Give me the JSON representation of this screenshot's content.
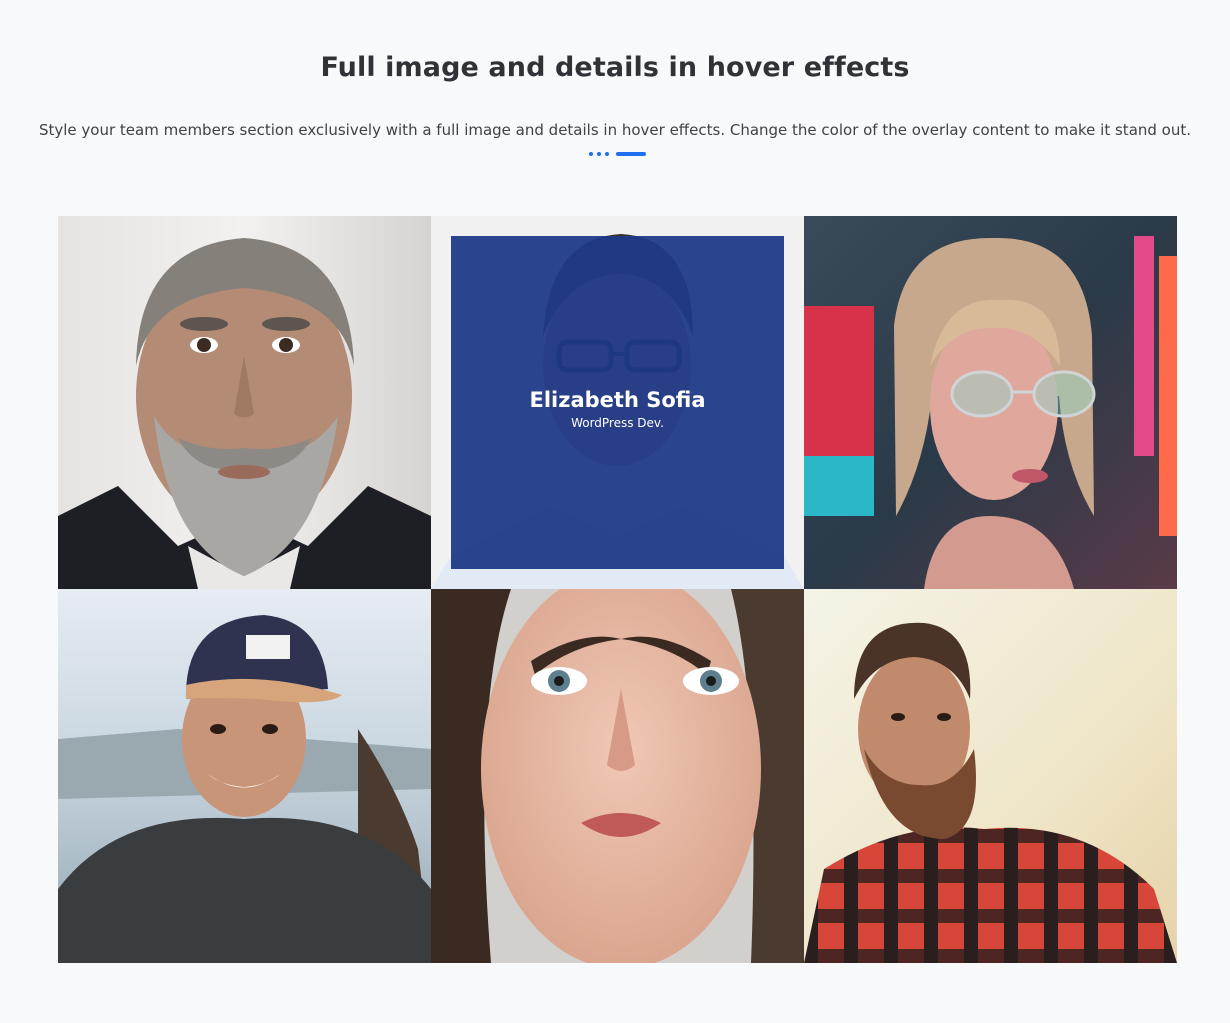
{
  "header": {
    "title": "Full image and details in hover effects",
    "subtitle": "Style your team members section exclusively with a full image and details in hover effects. Change the color of the overlay content to make it stand out."
  },
  "colors": {
    "accent": "#1f6ff0",
    "overlay": "#1f3a87",
    "background": "#f8f9fa"
  },
  "team": [
    {
      "photo": "bearded-man-portrait"
    },
    {
      "photo": "man-with-glasses-portrait",
      "name": "Elizabeth Sofia",
      "role": "WordPress Dev.",
      "hovered": true
    },
    {
      "photo": "woman-with-glasses-neon-portrait"
    },
    {
      "photo": "smiling-man-with-cap-portrait"
    },
    {
      "photo": "freckled-woman-portrait"
    },
    {
      "photo": "bearded-man-plaid-shirt-portrait"
    }
  ]
}
